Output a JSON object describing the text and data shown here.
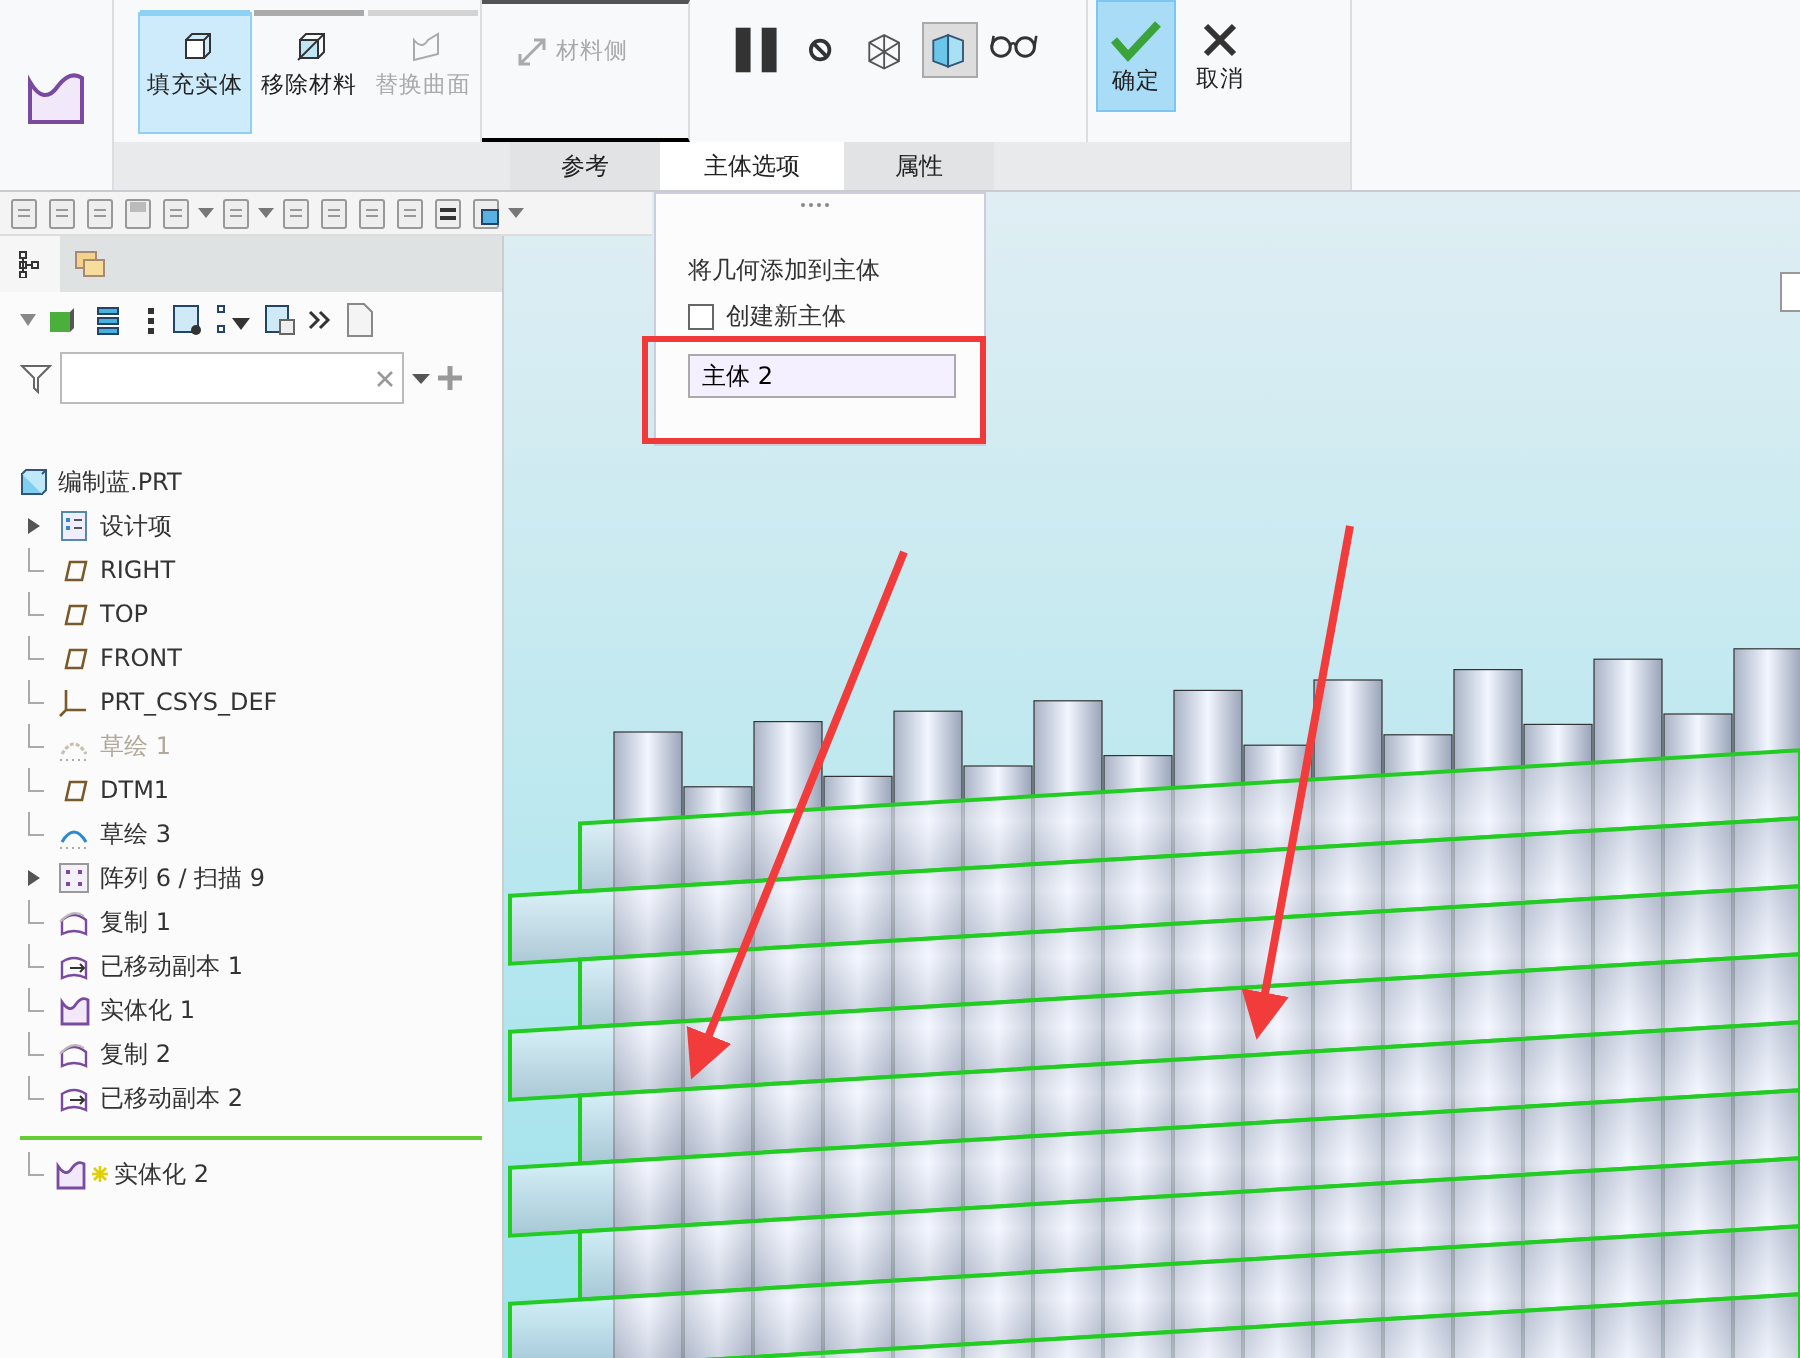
{
  "ribbon": {
    "buttons": [
      {
        "label": "填充实体",
        "kind": "fill",
        "selected": true,
        "disabled": false
      },
      {
        "label": "移除材料",
        "kind": "remove",
        "selected": false,
        "disabled": false
      },
      {
        "label": "替换曲面",
        "kind": "replace",
        "selected": false,
        "disabled": true
      }
    ],
    "material_side": {
      "label": "材料侧",
      "disabled": true
    },
    "tools": [
      {
        "kind": "pause",
        "selected": false
      },
      {
        "kind": "stop",
        "selected": false
      },
      {
        "kind": "wire",
        "selected": false
      },
      {
        "kind": "shaded",
        "selected": true
      },
      {
        "kind": "glasses",
        "selected": false
      }
    ],
    "ok_button": {
      "label": "确定",
      "selected": true
    },
    "cancel_button": {
      "label": "取消"
    }
  },
  "tabs": [
    {
      "label": "参考",
      "selected": false
    },
    {
      "label": "主体选项",
      "selected": true
    },
    {
      "label": "属性",
      "selected": false
    }
  ],
  "body_options": {
    "heading": "将几何添加到主体",
    "checkbox": {
      "label": "创建新主体",
      "checked": false
    },
    "body_field": {
      "value": "主体 2"
    }
  },
  "tree": {
    "root": "编制蓝.PRT",
    "items": [
      {
        "label": "设计项",
        "kind": "design",
        "expandable": true,
        "disabled": false
      },
      {
        "label": "RIGHT",
        "kind": "plane",
        "expandable": false,
        "disabled": false
      },
      {
        "label": "TOP",
        "kind": "plane",
        "expandable": false,
        "disabled": false
      },
      {
        "label": "FRONT",
        "kind": "plane",
        "expandable": false,
        "disabled": false
      },
      {
        "label": "PRT_CSYS_DEF",
        "kind": "csys",
        "expandable": false,
        "disabled": false
      },
      {
        "label": "草绘 1",
        "kind": "sketch",
        "expandable": false,
        "disabled": true
      },
      {
        "label": "DTM1",
        "kind": "plane",
        "expandable": false,
        "disabled": false
      },
      {
        "label": "草绘 3",
        "kind": "sketch",
        "expandable": false,
        "disabled": false
      },
      {
        "label": "阵列 6 / 扫描 9",
        "kind": "pattern",
        "expandable": true,
        "disabled": false
      },
      {
        "label": "复制 1",
        "kind": "copy",
        "expandable": false,
        "disabled": false
      },
      {
        "label": "已移动副本 1",
        "kind": "moved",
        "expandable": false,
        "disabled": false
      },
      {
        "label": "实体化 1",
        "kind": "solidify",
        "expandable": false,
        "disabled": false
      },
      {
        "label": "复制 2",
        "kind": "copy",
        "expandable": false,
        "disabled": false
      },
      {
        "label": "已移动副本 2",
        "kind": "moved",
        "expandable": false,
        "disabled": false
      }
    ],
    "insert_item": {
      "label": "实体化 2",
      "kind": "solidify",
      "new": true
    }
  }
}
